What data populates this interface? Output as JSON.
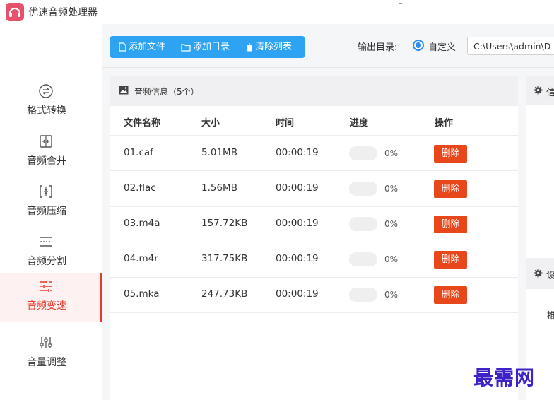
{
  "app": {
    "title": "优速音频处理器"
  },
  "sidebar": {
    "items": [
      {
        "label": "格式转换",
        "icon": "format-convert-icon",
        "active": false
      },
      {
        "label": "音频合并",
        "icon": "audio-merge-icon",
        "active": false
      },
      {
        "label": "音频压缩",
        "icon": "audio-compress-icon",
        "active": false
      },
      {
        "label": "音频分割",
        "icon": "audio-split-icon",
        "active": false
      },
      {
        "label": "音频变速",
        "icon": "audio-speed-icon",
        "active": true
      },
      {
        "label": "音量调整",
        "icon": "volume-adjust-icon",
        "active": false
      }
    ]
  },
  "toolbar": {
    "add_file": "添加文件",
    "add_folder": "添加目录",
    "clear_list": "清除列表",
    "output_label": "输出目录:",
    "radio_label": "自定义",
    "output_path": "C:\\Users\\admin\\D"
  },
  "panel": {
    "title": "音频信息（5个）",
    "columns": [
      "文件名称",
      "大小",
      "时间",
      "进度",
      "操作"
    ],
    "rows": [
      {
        "name": "01.caf",
        "size": "5.01MB",
        "time": "00:00:19",
        "progress": "0%",
        "action": "删除"
      },
      {
        "name": "02.flac",
        "size": "1.56MB",
        "time": "00:00:19",
        "progress": "0%",
        "action": "删除"
      },
      {
        "name": "03.m4a",
        "size": "157.72KB",
        "time": "00:00:19",
        "progress": "0%",
        "action": "删除"
      },
      {
        "name": "04.m4r",
        "size": "317.75KB",
        "time": "00:00:19",
        "progress": "0%",
        "action": "删除"
      },
      {
        "name": "05.mka",
        "size": "247.73KB",
        "time": "00:00:19",
        "progress": "0%",
        "action": "删除"
      }
    ]
  },
  "right": {
    "panel1_title": "信",
    "panel2_title": "设",
    "panel2_text": "推"
  },
  "watermark": "最需网",
  "colors": {
    "accent_blue": "#2ea3f2",
    "active_red": "#e83a2e",
    "delete_red": "#e8471c",
    "logo_pink": "#e8516b"
  }
}
